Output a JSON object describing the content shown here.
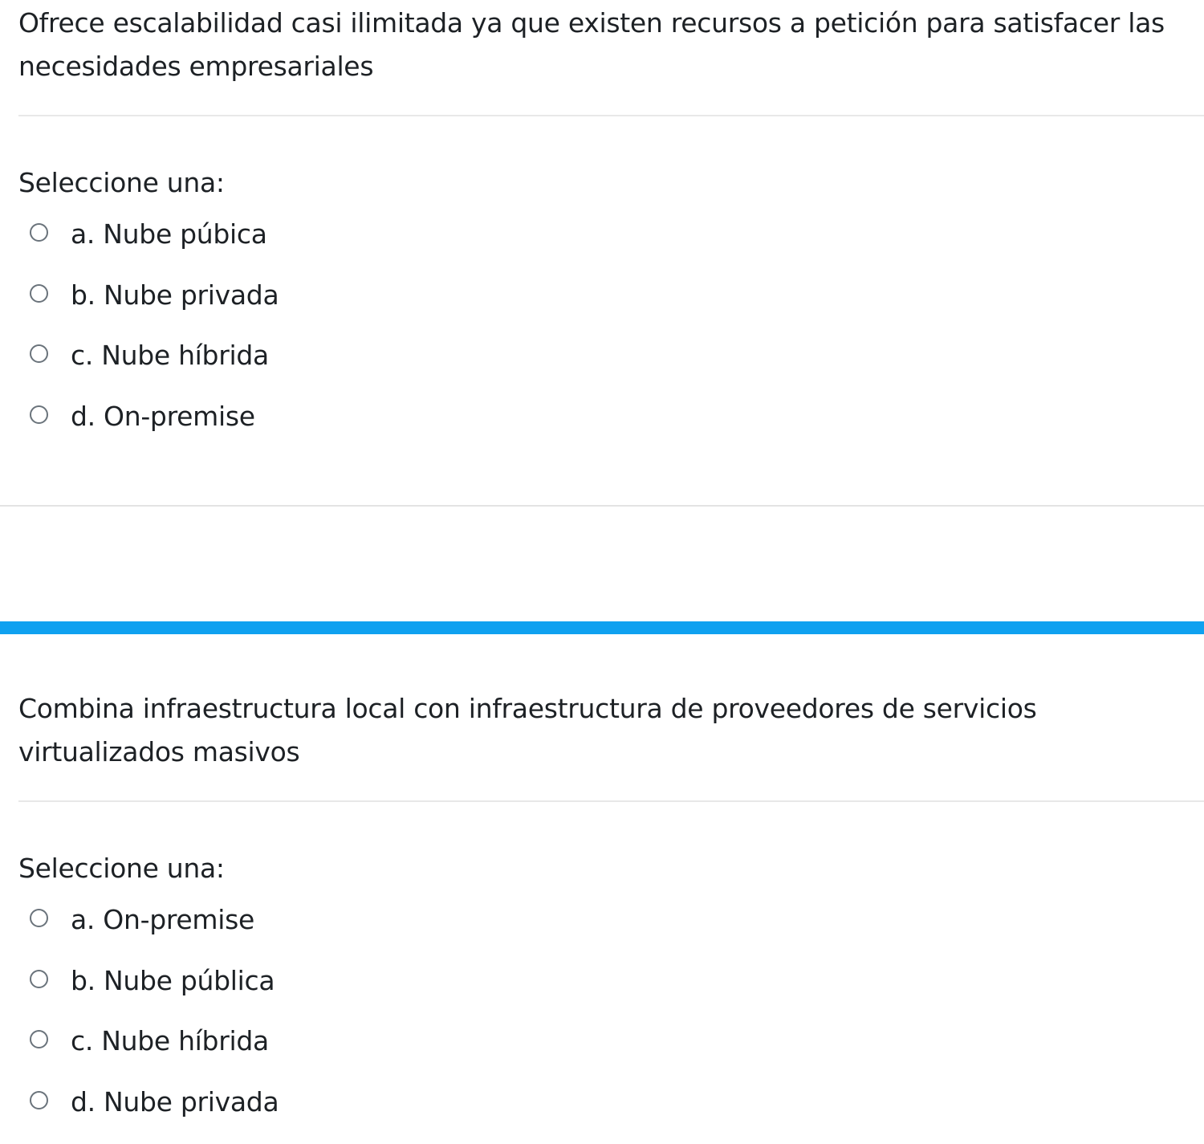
{
  "colors": {
    "text": "#1d2125",
    "divider": "#e8e8e8",
    "radio_border": "#6a737b",
    "separator": "#0fa1f0"
  },
  "questions": [
    {
      "text": "Ofrece escalabilidad casi ilimitada ya que existen recursos a petición para satisfacer las necesidades empresariales",
      "prompt": "Seleccione una:",
      "options": [
        {
          "label": "a. Nube púbica",
          "selected": false
        },
        {
          "label": "b. Nube privada",
          "selected": false
        },
        {
          "label": "c. Nube híbrida",
          "selected": false
        },
        {
          "label": "d. On-premise",
          "selected": false
        }
      ]
    },
    {
      "text": "Combina infraestructura local con infraestructura de proveedores de servicios virtualizados masivos",
      "prompt": "Seleccione una:",
      "options": [
        {
          "label": "a. On-premise",
          "selected": false
        },
        {
          "label": "b. Nube pública",
          "selected": false
        },
        {
          "label": "c. Nube híbrida",
          "selected": false
        },
        {
          "label": "d. Nube privada",
          "selected": false
        }
      ]
    }
  ]
}
